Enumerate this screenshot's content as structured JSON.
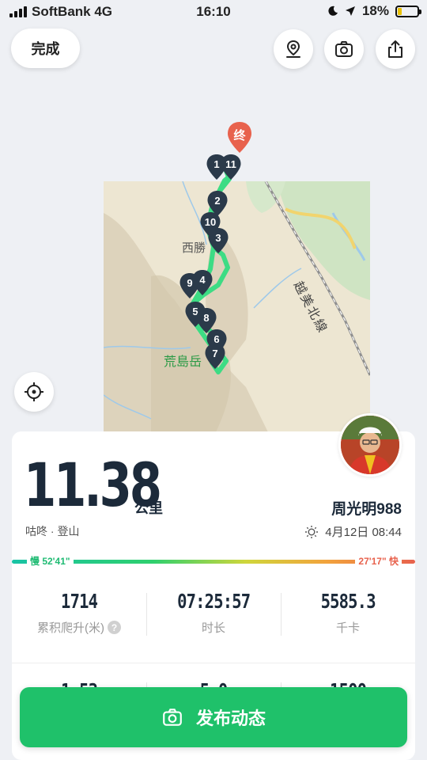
{
  "status": {
    "carrier": "SoftBank 4G",
    "time": "16:10",
    "battery": "18%"
  },
  "toolbar": {
    "done_label": "完成",
    "icons": [
      "map-pin-icon",
      "camera-icon",
      "share-icon"
    ]
  },
  "map": {
    "labels": {
      "nishi": "西勝",
      "arashima": "荒島岳",
      "railway": "越美北線"
    },
    "finish_marker": "终",
    "markers": [
      "1",
      "11",
      "2",
      "10",
      "3",
      "4",
      "9",
      "5",
      "8",
      "6",
      "7"
    ],
    "route_color": "#3ddc84"
  },
  "summary": {
    "distance": "11.38",
    "unit": "公里",
    "sport": "咕咚 · 登山",
    "username": "周光明988",
    "datetime": "4月12日 08:44"
  },
  "pace": {
    "slow": "慢 52'41\"",
    "fast": "27'17\" 快"
  },
  "stats": [
    {
      "value": "1714",
      "label": "累积爬升(米)"
    },
    {
      "value": "07:25:57",
      "label": "时长"
    },
    {
      "value": "5585.3",
      "label": "千卡"
    }
  ],
  "stats_row2_partial": [
    "1.53",
    "5.0",
    "1500"
  ],
  "publish": {
    "label": "发布动态"
  },
  "colors": {
    "accent": "#1fc16a",
    "marker": "#2b3a4a",
    "finish": "#e8624d"
  }
}
